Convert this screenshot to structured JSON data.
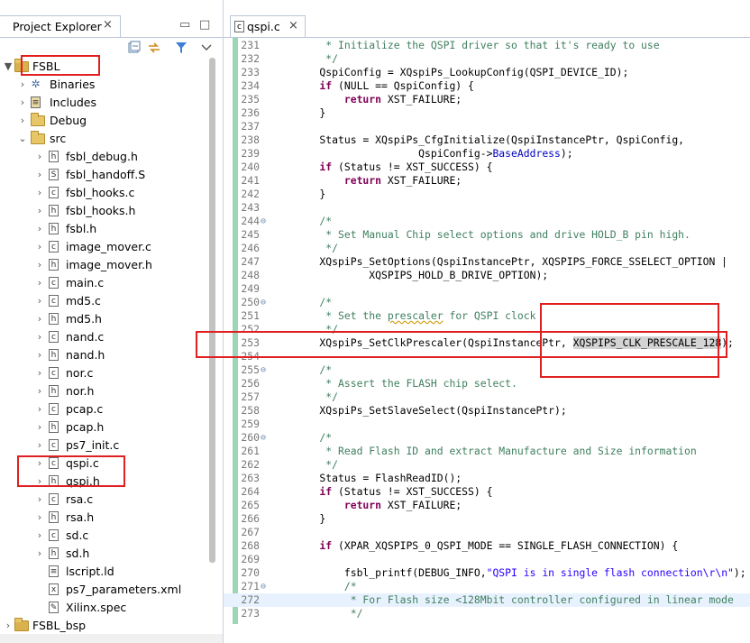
{
  "explorer": {
    "title": "Project Explorer",
    "close_glyph": "×",
    "minimize_glyph": "▭",
    "maximize_glyph": "□",
    "tree": [
      {
        "label": "FSBL",
        "level": 0,
        "kind": "project",
        "twisty": "▼"
      },
      {
        "label": "Binaries",
        "level": 1,
        "kind": "binaries",
        "twisty": "›"
      },
      {
        "label": "Includes",
        "level": 1,
        "kind": "includes",
        "twisty": "›"
      },
      {
        "label": "Debug",
        "level": 1,
        "kind": "folder",
        "twisty": "›"
      },
      {
        "label": "src",
        "level": 1,
        "kind": "folder",
        "twisty": "⌄"
      },
      {
        "label": "fsbl_debug.h",
        "level": 2,
        "kind": "h",
        "twisty": "›"
      },
      {
        "label": "fsbl_handoff.S",
        "level": 2,
        "kind": "S",
        "twisty": "›"
      },
      {
        "label": "fsbl_hooks.c",
        "level": 2,
        "kind": "c",
        "twisty": "›"
      },
      {
        "label": "fsbl_hooks.h",
        "level": 2,
        "kind": "h",
        "twisty": "›"
      },
      {
        "label": "fsbl.h",
        "level": 2,
        "kind": "h",
        "twisty": "›"
      },
      {
        "label": "image_mover.c",
        "level": 2,
        "kind": "c",
        "twisty": "›"
      },
      {
        "label": "image_mover.h",
        "level": 2,
        "kind": "h",
        "twisty": "›"
      },
      {
        "label": "main.c",
        "level": 2,
        "kind": "c",
        "twisty": "›"
      },
      {
        "label": "md5.c",
        "level": 2,
        "kind": "c",
        "twisty": "›"
      },
      {
        "label": "md5.h",
        "level": 2,
        "kind": "h",
        "twisty": "›"
      },
      {
        "label": "nand.c",
        "level": 2,
        "kind": "c",
        "twisty": "›"
      },
      {
        "label": "nand.h",
        "level": 2,
        "kind": "h",
        "twisty": "›"
      },
      {
        "label": "nor.c",
        "level": 2,
        "kind": "c",
        "twisty": "›"
      },
      {
        "label": "nor.h",
        "level": 2,
        "kind": "h",
        "twisty": "›"
      },
      {
        "label": "pcap.c",
        "level": 2,
        "kind": "c",
        "twisty": "›"
      },
      {
        "label": "pcap.h",
        "level": 2,
        "kind": "h",
        "twisty": "›"
      },
      {
        "label": "ps7_init.c",
        "level": 2,
        "kind": "c",
        "twisty": "›"
      },
      {
        "label": "qspi.c",
        "level": 2,
        "kind": "c",
        "twisty": "›"
      },
      {
        "label": "qspi.h",
        "level": 2,
        "kind": "h",
        "twisty": "›"
      },
      {
        "label": "rsa.c",
        "level": 2,
        "kind": "c",
        "twisty": "›"
      },
      {
        "label": "rsa.h",
        "level": 2,
        "kind": "h",
        "twisty": "›"
      },
      {
        "label": "sd.c",
        "level": 2,
        "kind": "c",
        "twisty": "›"
      },
      {
        "label": "sd.h",
        "level": 2,
        "kind": "h",
        "twisty": "›"
      },
      {
        "label": "lscript.ld",
        "level": 2,
        "kind": "ld",
        "twisty": ""
      },
      {
        "label": "ps7_parameters.xml",
        "level": 2,
        "kind": "xml",
        "twisty": ""
      },
      {
        "label": "Xilinx.spec",
        "level": 2,
        "kind": "spec",
        "twisty": ""
      },
      {
        "label": "FSBL_bsp",
        "level": 0,
        "kind": "project",
        "twisty": "›"
      }
    ]
  },
  "editor": {
    "tab_title": "qspi.c",
    "tab_icon": "c",
    "close_glyph": "×",
    "fold_glyph": "⊖",
    "lines": [
      {
        "n": "231",
        "parts": [
          [
            "com",
            "     * Initialize the QSPI driver so that it's ready to use"
          ]
        ]
      },
      {
        "n": "232",
        "parts": [
          [
            "com",
            "     */"
          ]
        ]
      },
      {
        "n": "233",
        "parts": [
          [
            "txt",
            "    QspiConfig = XQspiPs_LookupConfig(QSPI_DEVICE_ID);"
          ]
        ]
      },
      {
        "n": "234",
        "parts": [
          [
            "kw",
            "    if"
          ],
          [
            "txt",
            " (NULL == QspiConfig) {"
          ]
        ]
      },
      {
        "n": "235",
        "parts": [
          [
            "kw",
            "        return"
          ],
          [
            "txt",
            " XST_FAILURE;"
          ]
        ]
      },
      {
        "n": "236",
        "parts": [
          [
            "txt",
            "    }"
          ]
        ]
      },
      {
        "n": "237",
        "parts": [
          [
            "txt",
            ""
          ]
        ]
      },
      {
        "n": "238",
        "parts": [
          [
            "txt",
            "    Status = XQspiPs_CfgInitialize(QspiInstancePtr, QspiConfig,"
          ]
        ]
      },
      {
        "n": "239",
        "parts": [
          [
            "txt",
            "                    QspiConfig->"
          ],
          [
            "fld",
            "BaseAddress"
          ],
          [
            "txt",
            ");"
          ]
        ]
      },
      {
        "n": "240",
        "parts": [
          [
            "kw",
            "    if"
          ],
          [
            "txt",
            " (Status != XST_SUCCESS) {"
          ]
        ]
      },
      {
        "n": "241",
        "parts": [
          [
            "kw",
            "        return"
          ],
          [
            "txt",
            " XST_FAILURE;"
          ]
        ]
      },
      {
        "n": "242",
        "parts": [
          [
            "txt",
            "    }"
          ]
        ]
      },
      {
        "n": "243",
        "parts": [
          [
            "txt",
            ""
          ]
        ]
      },
      {
        "n": "244",
        "fold": true,
        "parts": [
          [
            "com",
            "    /*"
          ]
        ]
      },
      {
        "n": "245",
        "parts": [
          [
            "com",
            "     * Set Manual Chip select options and drive HOLD_B pin high."
          ]
        ]
      },
      {
        "n": "246",
        "parts": [
          [
            "com",
            "     */"
          ]
        ]
      },
      {
        "n": "247",
        "parts": [
          [
            "txt",
            "    XQspiPs_SetOptions(QspiInstancePtr, XQSPIPS_FORCE_SSELECT_OPTION |"
          ]
        ]
      },
      {
        "n": "248",
        "parts": [
          [
            "txt",
            "            XQSPIPS_HOLD_B_DRIVE_OPTION);"
          ]
        ]
      },
      {
        "n": "249",
        "parts": [
          [
            "txt",
            ""
          ]
        ]
      },
      {
        "n": "250",
        "fold": true,
        "parts": [
          [
            "com",
            "    /*"
          ]
        ]
      },
      {
        "n": "251",
        "parts": [
          [
            "com",
            "     * Set the "
          ],
          [
            "comw",
            "prescaler"
          ],
          [
            "com",
            " for QSPI clock"
          ]
        ]
      },
      {
        "n": "252",
        "parts": [
          [
            "com",
            "     */"
          ]
        ]
      },
      {
        "n": "253",
        "parts": [
          [
            "txt",
            "    XQspiPs_SetClkPrescaler(QspiInstancePtr, "
          ],
          [
            "sel",
            "XQSPIPS_CLK_PRESCALE_128"
          ],
          [
            "txt",
            ");"
          ]
        ]
      },
      {
        "n": "254",
        "parts": [
          [
            "txt",
            ""
          ]
        ]
      },
      {
        "n": "255",
        "fold": true,
        "parts": [
          [
            "com",
            "    /*"
          ]
        ]
      },
      {
        "n": "256",
        "parts": [
          [
            "com",
            "     * Assert the FLASH chip select."
          ]
        ]
      },
      {
        "n": "257",
        "parts": [
          [
            "com",
            "     */"
          ]
        ]
      },
      {
        "n": "258",
        "parts": [
          [
            "txt",
            "    XQspiPs_SetSlaveSelect(QspiInstancePtr);"
          ]
        ]
      },
      {
        "n": "259",
        "parts": [
          [
            "txt",
            ""
          ]
        ]
      },
      {
        "n": "260",
        "fold": true,
        "parts": [
          [
            "com",
            "    /*"
          ]
        ]
      },
      {
        "n": "261",
        "parts": [
          [
            "com",
            "     * Read Flash ID and extract Manufacture and Size information"
          ]
        ]
      },
      {
        "n": "262",
        "parts": [
          [
            "com",
            "     */"
          ]
        ]
      },
      {
        "n": "263",
        "parts": [
          [
            "txt",
            "    Status = FlashReadID();"
          ]
        ]
      },
      {
        "n": "264",
        "parts": [
          [
            "kw",
            "    if"
          ],
          [
            "txt",
            " (Status != XST_SUCCESS) {"
          ]
        ]
      },
      {
        "n": "265",
        "parts": [
          [
            "kw",
            "        return"
          ],
          [
            "txt",
            " XST_FAILURE;"
          ]
        ]
      },
      {
        "n": "266",
        "parts": [
          [
            "txt",
            "    }"
          ]
        ]
      },
      {
        "n": "267",
        "parts": [
          [
            "txt",
            ""
          ]
        ]
      },
      {
        "n": "268",
        "parts": [
          [
            "kw",
            "    if"
          ],
          [
            "txt",
            " (XPAR_XQSPIPS_0_QSPI_MODE == SINGLE_FLASH_CONNECTION) {"
          ]
        ]
      },
      {
        "n": "269",
        "parts": [
          [
            "txt",
            ""
          ]
        ]
      },
      {
        "n": "270",
        "parts": [
          [
            "txt",
            "        fsbl_printf(DEBUG_INFO,"
          ],
          [
            "str",
            "\"QSPI is in single flash connection\\r\\n\""
          ],
          [
            "txt",
            ");"
          ]
        ]
      },
      {
        "n": "271",
        "fold": true,
        "parts": [
          [
            "com",
            "        /*"
          ]
        ]
      },
      {
        "n": "272",
        "hl": true,
        "parts": [
          [
            "com",
            "         * For Flash size <128Mbit controller configured in linear mode"
          ]
        ]
      },
      {
        "n": "273",
        "parts": [
          [
            "com",
            "         */"
          ]
        ]
      }
    ]
  }
}
